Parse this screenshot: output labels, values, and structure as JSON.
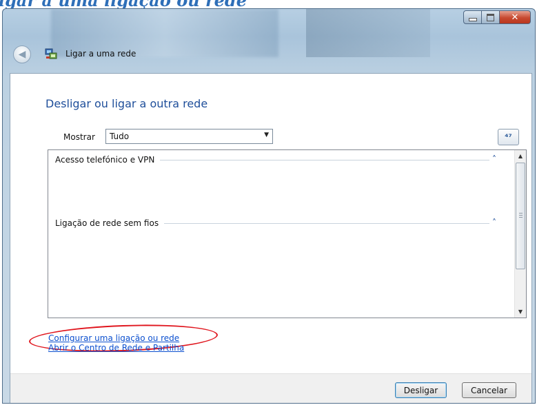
{
  "page": {
    "heading": "igar a uma ligação ou rede"
  },
  "window": {
    "title": "Ligar a uma rede",
    "caption": {
      "minimize": "minimize-icon",
      "maximize": "maximize-icon",
      "close": "✕"
    },
    "back_icon": "◀"
  },
  "main": {
    "title": "Desligar ou ligar a outra rede",
    "show": {
      "label": "Mostrar",
      "selected": "Tudo",
      "arrow": "▼"
    },
    "refresh_icon": "⁴⁷",
    "groups": [
      {
        "label": "Acesso telefónico e VPN",
        "chevron": "˄"
      },
      {
        "label": "Ligação de rede sem fios",
        "chevron": "˄"
      }
    ],
    "scroll": {
      "up": "▲",
      "down": "▼"
    }
  },
  "links": {
    "setup": "Configurar uma ligação ou rede",
    "network_center": "Abrir o Centro de Rede e Partilha"
  },
  "footer": {
    "disconnect": "Desligar",
    "cancel": "Cancelar"
  },
  "colors": {
    "accent": "#1e4e9a",
    "link": "#0b4fcf",
    "highlight": "#e0161e"
  }
}
